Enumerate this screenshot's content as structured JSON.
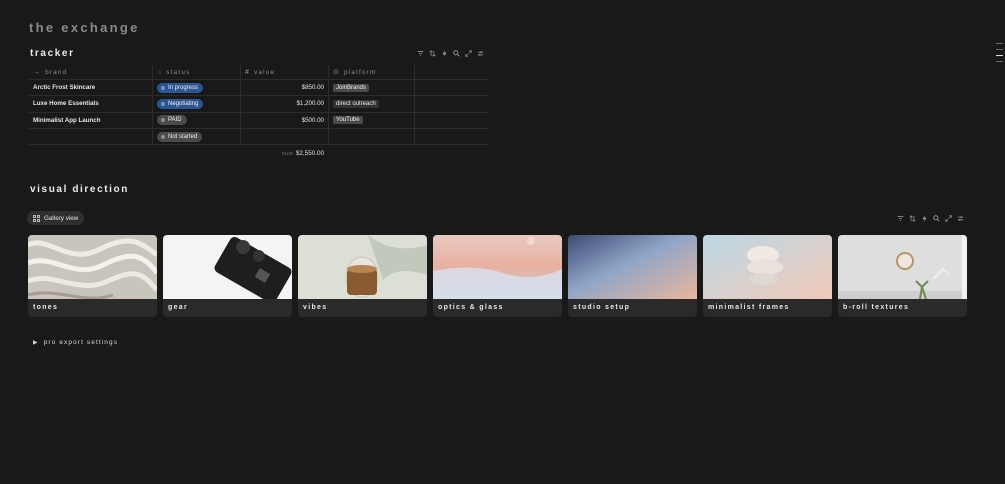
{
  "page": {
    "title": "the exchange"
  },
  "tracker": {
    "title": "tracker",
    "columns": [
      "brand",
      "status",
      "value",
      "platform"
    ],
    "rows": [
      {
        "brand": "Arctic Frost Skincare",
        "status": "In progress",
        "value": "$850.00",
        "platform": "JoinBrands"
      },
      {
        "brand": "Luxe Home Essentials",
        "status": "Negotiating",
        "value": "$1,200.00",
        "platform": "direct outreach"
      },
      {
        "brand": "Minimalist App Launch",
        "status": "PAID",
        "value": "$500.00",
        "platform": "YouTube"
      },
      {
        "brand": "",
        "status": "Not started",
        "value": "",
        "platform": ""
      }
    ],
    "sum_label": "SUM",
    "sum_value": "$2,550.00"
  },
  "visual": {
    "title": "visual direction",
    "view_label": "Gallery view",
    "cards": [
      "tones",
      "gear",
      "vibes",
      "optics & glass",
      "studio setup",
      "minimalist frames",
      "b-roll textures"
    ]
  },
  "toggle": {
    "label": "pro export settings"
  },
  "toolbar_icons": [
    "filter-icon",
    "sort-icon",
    "lightning-icon",
    "search-icon",
    "expand-icon",
    "settings-icon"
  ],
  "colors": {
    "background": "#191919",
    "pill_blue": "#2d5592",
    "pill_gray": "#4b4b4b"
  }
}
